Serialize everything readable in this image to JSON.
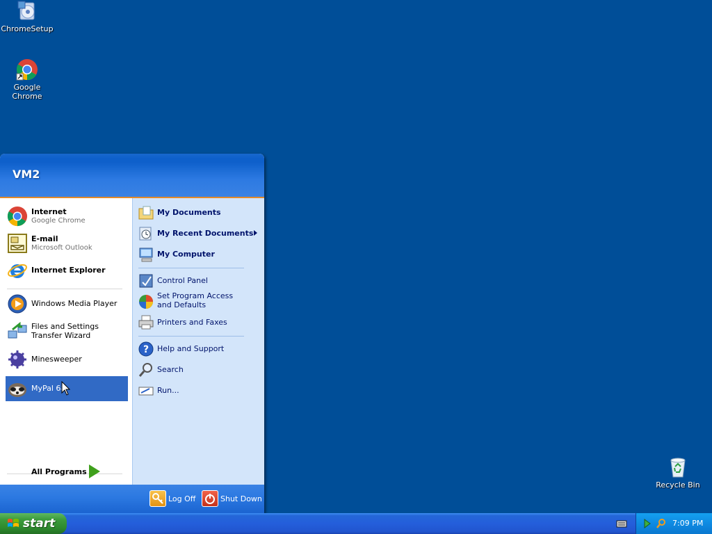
{
  "desktop": {
    "icons": [
      {
        "label": "ChromeSetup"
      },
      {
        "label": "Google Chrome"
      },
      {
        "label": "Recycle Bin"
      }
    ]
  },
  "start_menu": {
    "user": "VM2",
    "pinned": [
      {
        "title": "Internet",
        "subtitle": "Google Chrome",
        "icon": "chrome-icon"
      },
      {
        "title": "E-mail",
        "subtitle": "Microsoft Outlook",
        "icon": "outlook-icon"
      }
    ],
    "pinned_single": {
      "title": "Internet Explorer",
      "icon": "internet-explorer-icon"
    },
    "recent": [
      {
        "title": "Windows Media Player",
        "icon": "media-player-icon"
      },
      {
        "title": "Files and Settings Transfer Wizard",
        "icon": "transfer-wizard-icon"
      },
      {
        "title": "Minesweeper",
        "icon": "minesweeper-icon"
      },
      {
        "title": "MyPal 68",
        "icon": "mypal-icon",
        "selected": true
      }
    ],
    "all_programs": "All Programs",
    "right": {
      "my_documents": "My Documents",
      "my_recent_documents": "My Recent Documents",
      "my_computer": "My Computer",
      "control_panel": "Control Panel",
      "set_program_access": "Set Program Access and Defaults",
      "printers_faxes": "Printers and Faxes",
      "help_support": "Help and Support",
      "search": "Search",
      "run": "Run..."
    },
    "footer": {
      "log_off": "Log Off",
      "shut_down": "Shut Down"
    }
  },
  "taskbar": {
    "start_label": "start",
    "clock": "7:09 PM"
  },
  "colors": {
    "desktop": "#004e98",
    "selection": "#316ac5",
    "start_green": "#3c9c3c"
  }
}
